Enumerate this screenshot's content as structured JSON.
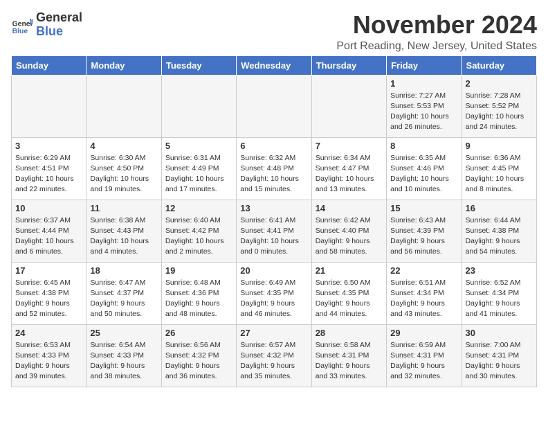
{
  "header": {
    "logo_general": "General",
    "logo_blue": "Blue",
    "month_title": "November 2024",
    "subtitle": "Port Reading, New Jersey, United States"
  },
  "days_of_week": [
    "Sunday",
    "Monday",
    "Tuesday",
    "Wednesday",
    "Thursday",
    "Friday",
    "Saturday"
  ],
  "weeks": [
    [
      {
        "day": "",
        "info": ""
      },
      {
        "day": "",
        "info": ""
      },
      {
        "day": "",
        "info": ""
      },
      {
        "day": "",
        "info": ""
      },
      {
        "day": "",
        "info": ""
      },
      {
        "day": "1",
        "info": "Sunrise: 7:27 AM\nSunset: 5:53 PM\nDaylight: 10 hours and 26 minutes."
      },
      {
        "day": "2",
        "info": "Sunrise: 7:28 AM\nSunset: 5:52 PM\nDaylight: 10 hours and 24 minutes."
      }
    ],
    [
      {
        "day": "3",
        "info": "Sunrise: 6:29 AM\nSunset: 4:51 PM\nDaylight: 10 hours and 22 minutes."
      },
      {
        "day": "4",
        "info": "Sunrise: 6:30 AM\nSunset: 4:50 PM\nDaylight: 10 hours and 19 minutes."
      },
      {
        "day": "5",
        "info": "Sunrise: 6:31 AM\nSunset: 4:49 PM\nDaylight: 10 hours and 17 minutes."
      },
      {
        "day": "6",
        "info": "Sunrise: 6:32 AM\nSunset: 4:48 PM\nDaylight: 10 hours and 15 minutes."
      },
      {
        "day": "7",
        "info": "Sunrise: 6:34 AM\nSunset: 4:47 PM\nDaylight: 10 hours and 13 minutes."
      },
      {
        "day": "8",
        "info": "Sunrise: 6:35 AM\nSunset: 4:46 PM\nDaylight: 10 hours and 10 minutes."
      },
      {
        "day": "9",
        "info": "Sunrise: 6:36 AM\nSunset: 4:45 PM\nDaylight: 10 hours and 8 minutes."
      }
    ],
    [
      {
        "day": "10",
        "info": "Sunrise: 6:37 AM\nSunset: 4:44 PM\nDaylight: 10 hours and 6 minutes."
      },
      {
        "day": "11",
        "info": "Sunrise: 6:38 AM\nSunset: 4:43 PM\nDaylight: 10 hours and 4 minutes."
      },
      {
        "day": "12",
        "info": "Sunrise: 6:40 AM\nSunset: 4:42 PM\nDaylight: 10 hours and 2 minutes."
      },
      {
        "day": "13",
        "info": "Sunrise: 6:41 AM\nSunset: 4:41 PM\nDaylight: 10 hours and 0 minutes."
      },
      {
        "day": "14",
        "info": "Sunrise: 6:42 AM\nSunset: 4:40 PM\nDaylight: 9 hours and 58 minutes."
      },
      {
        "day": "15",
        "info": "Sunrise: 6:43 AM\nSunset: 4:39 PM\nDaylight: 9 hours and 56 minutes."
      },
      {
        "day": "16",
        "info": "Sunrise: 6:44 AM\nSunset: 4:38 PM\nDaylight: 9 hours and 54 minutes."
      }
    ],
    [
      {
        "day": "17",
        "info": "Sunrise: 6:45 AM\nSunset: 4:38 PM\nDaylight: 9 hours and 52 minutes."
      },
      {
        "day": "18",
        "info": "Sunrise: 6:47 AM\nSunset: 4:37 PM\nDaylight: 9 hours and 50 minutes."
      },
      {
        "day": "19",
        "info": "Sunrise: 6:48 AM\nSunset: 4:36 PM\nDaylight: 9 hours and 48 minutes."
      },
      {
        "day": "20",
        "info": "Sunrise: 6:49 AM\nSunset: 4:35 PM\nDaylight: 9 hours and 46 minutes."
      },
      {
        "day": "21",
        "info": "Sunrise: 6:50 AM\nSunset: 4:35 PM\nDaylight: 9 hours and 44 minutes."
      },
      {
        "day": "22",
        "info": "Sunrise: 6:51 AM\nSunset: 4:34 PM\nDaylight: 9 hours and 43 minutes."
      },
      {
        "day": "23",
        "info": "Sunrise: 6:52 AM\nSunset: 4:34 PM\nDaylight: 9 hours and 41 minutes."
      }
    ],
    [
      {
        "day": "24",
        "info": "Sunrise: 6:53 AM\nSunset: 4:33 PM\nDaylight: 9 hours and 39 minutes."
      },
      {
        "day": "25",
        "info": "Sunrise: 6:54 AM\nSunset: 4:33 PM\nDaylight: 9 hours and 38 minutes."
      },
      {
        "day": "26",
        "info": "Sunrise: 6:56 AM\nSunset: 4:32 PM\nDaylight: 9 hours and 36 minutes."
      },
      {
        "day": "27",
        "info": "Sunrise: 6:57 AM\nSunset: 4:32 PM\nDaylight: 9 hours and 35 minutes."
      },
      {
        "day": "28",
        "info": "Sunrise: 6:58 AM\nSunset: 4:31 PM\nDaylight: 9 hours and 33 minutes."
      },
      {
        "day": "29",
        "info": "Sunrise: 6:59 AM\nSunset: 4:31 PM\nDaylight: 9 hours and 32 minutes."
      },
      {
        "day": "30",
        "info": "Sunrise: 7:00 AM\nSunset: 4:31 PM\nDaylight: 9 hours and 30 minutes."
      }
    ]
  ]
}
